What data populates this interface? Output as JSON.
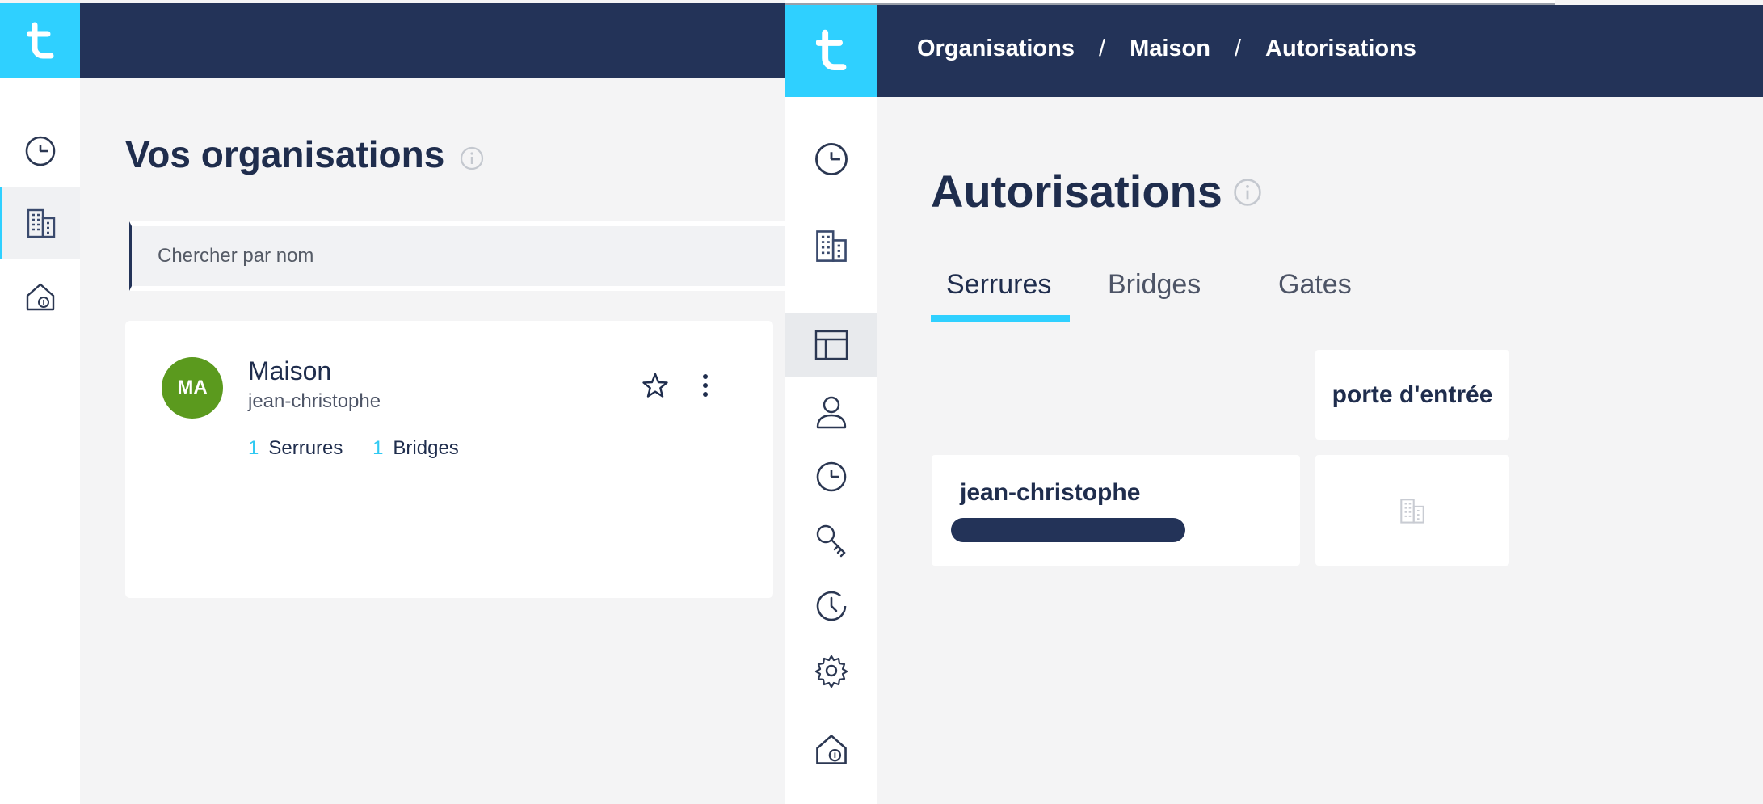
{
  "left": {
    "page_title": "Vos organisations",
    "search": {
      "placeholder": "Chercher par nom"
    },
    "organization": {
      "initials": "MA",
      "name": "Maison",
      "owner": "jean-christophe",
      "stats": [
        {
          "count": "1",
          "label": "Serrures"
        },
        {
          "count": "1",
          "label": "Bridges"
        }
      ]
    }
  },
  "right": {
    "breadcrumb": [
      "Organisations",
      "Maison",
      "Autorisations"
    ],
    "breadcrumb_sep": "/",
    "page_title": "Autorisations",
    "tabs": [
      "Serrures",
      "Bridges",
      "Gates"
    ],
    "active_tab": "Serrures",
    "lock_column": "porte d'entrée",
    "user_row": {
      "name": "jean-christophe"
    }
  },
  "colors": {
    "accent": "#2fd0ff",
    "navy": "#233358",
    "avatar_green": "#5b9a1e",
    "count_blue": "#2fc9f2"
  }
}
